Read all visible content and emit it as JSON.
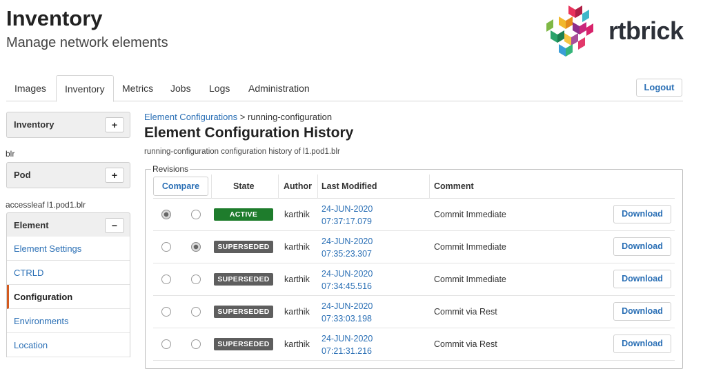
{
  "header": {
    "title": "Inventory",
    "subtitle": "Manage network elements",
    "logo_text": "rtbrick"
  },
  "nav": {
    "tabs": [
      {
        "label": "Images"
      },
      {
        "label": "Inventory",
        "active": true
      },
      {
        "label": "Metrics"
      },
      {
        "label": "Jobs"
      },
      {
        "label": "Logs"
      },
      {
        "label": "Administration"
      }
    ],
    "logout_label": "Logout"
  },
  "sidebar": {
    "inventory_panel": {
      "title": "Inventory",
      "button": "+"
    },
    "pod_label": "blr",
    "pod_panel": {
      "title": "Pod",
      "button": "+"
    },
    "element_label": "accessleaf l1.pod1.blr",
    "element_panel": {
      "title": "Element",
      "button": "−"
    },
    "menu": [
      {
        "label": "Element Settings"
      },
      {
        "label": "CTRLD"
      },
      {
        "label": "Configuration",
        "active": true
      },
      {
        "label": "Environments"
      },
      {
        "label": "Location"
      }
    ]
  },
  "main": {
    "breadcrumb": {
      "link": "Element Configurations",
      "separator": ">",
      "current": "running-configuration"
    },
    "title": "Element Configuration History",
    "description": "running-configuration configuration history of l1.pod1.blr",
    "revisions": {
      "legend": "Revisions",
      "columns": {
        "compare": "Compare",
        "state": "State",
        "author": "Author",
        "modified": "Last Modified",
        "comment": "Comment"
      },
      "download_label": "Download",
      "rows": [
        {
          "radio_a": true,
          "radio_b": false,
          "state": "ACTIVE",
          "state_kind": "active",
          "author": "karthik",
          "date": "24-JUN-2020",
          "time": "07:37:17.079",
          "comment": "Commit Immediate"
        },
        {
          "radio_a": false,
          "radio_b": true,
          "state": "SUPERSEDED",
          "state_kind": "superseded",
          "author": "karthik",
          "date": "24-JUN-2020",
          "time": "07:35:23.307",
          "comment": "Commit Immediate"
        },
        {
          "radio_a": false,
          "radio_b": false,
          "state": "SUPERSEDED",
          "state_kind": "superseded",
          "author": "karthik",
          "date": "24-JUN-2020",
          "time": "07:34:45.516",
          "comment": "Commit Immediate"
        },
        {
          "radio_a": false,
          "radio_b": false,
          "state": "SUPERSEDED",
          "state_kind": "superseded",
          "author": "karthik",
          "date": "24-JUN-2020",
          "time": "07:33:03.198",
          "comment": "Commit via Rest"
        },
        {
          "radio_a": false,
          "radio_b": false,
          "state": "SUPERSEDED",
          "state_kind": "superseded",
          "author": "karthik",
          "date": "24-JUN-2020",
          "time": "07:21:31.216",
          "comment": "Commit via Rest"
        }
      ]
    }
  },
  "colors": {
    "link": "#2a6fb5",
    "active_badge": "#1e7c2c",
    "superseded_badge": "#5e5e5e",
    "menu_active_marker": "#d35a1f"
  }
}
